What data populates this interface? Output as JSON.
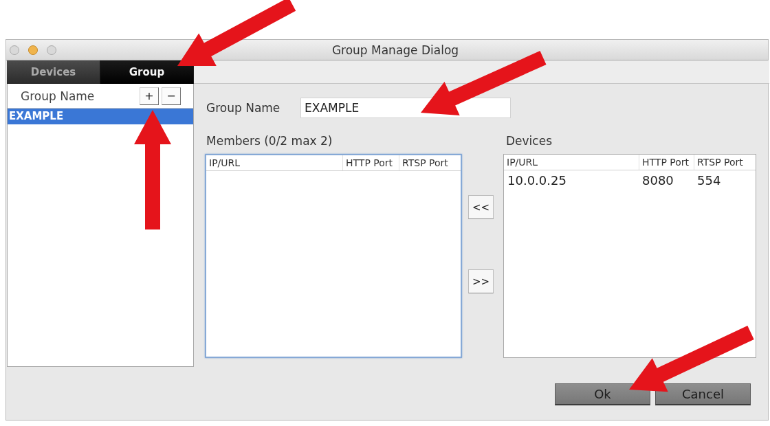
{
  "window": {
    "title": "Group Manage Dialog"
  },
  "tabs": [
    {
      "label": "Devices",
      "selected": false
    },
    {
      "label": "Group",
      "selected": true
    }
  ],
  "group_list": {
    "header": "Group Name",
    "add_button": "+",
    "remove_button": "−",
    "items": [
      {
        "label": "EXAMPLE",
        "selected": true
      }
    ]
  },
  "group_name": {
    "label": "Group Name",
    "value": "EXAMPLE"
  },
  "members": {
    "label": "Members (0/2 max 2)",
    "focused": true,
    "columns": [
      "IP/URL",
      "HTTP Port",
      "RTSP Port"
    ]
  },
  "transfer_buttons": [
    "<<",
    ">>"
  ],
  "devices": {
    "label": "Devices",
    "focused": false,
    "columns": [
      "IP/URL",
      "HTTP Port",
      "RTSP Port"
    ],
    "rows": [
      {
        "cells": [
          "10.0.0.25",
          "8080",
          "554"
        ],
        "selected": false
      }
    ]
  },
  "buttons": [
    "Ok",
    "Cancel"
  ]
}
